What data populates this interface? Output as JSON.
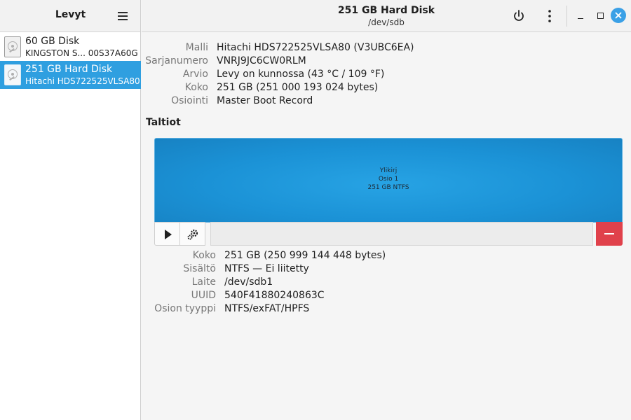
{
  "sidebar": {
    "title": "Levyt",
    "menu_icon": "hamburger-menu-icon",
    "disks": [
      {
        "name": "60 GB Disk",
        "subtitle": "KINGSTON S... 00S37A60G",
        "icon": "hard-disk-icon",
        "selected": false
      },
      {
        "name": "251 GB Hard Disk",
        "subtitle": "Hitachi HDS722525VLSA80",
        "icon": "hard-disk-icon",
        "selected": true
      }
    ]
  },
  "header": {
    "title": "251 GB Hard Disk",
    "subtitle": "/dev/sdb",
    "power_icon": "power-icon",
    "menu_icon": "vertical-dots-icon",
    "accent_close": "#3aa0e6"
  },
  "disk_info": [
    {
      "label": "Malli",
      "value": "Hitachi HDS722525VLSA80 (V3UBC6EA)"
    },
    {
      "label": "Sarjanumero",
      "value": "VNRJ9JC6CW0RLM"
    },
    {
      "label": "Arvio",
      "value": "Levy on kunnossa (43 °C / 109 °F)"
    },
    {
      "label": "Koko",
      "value": "251 GB (251 000 193 024 bytes)"
    },
    {
      "label": "Osiointi",
      "value": "Master Boot Record"
    }
  ],
  "volumes": {
    "section_title": "Taltiot",
    "block": {
      "line1": "Ylikirj",
      "line2": "Osio 1",
      "line3": "251 GB NTFS",
      "color": "#1b92d6"
    },
    "toolbar": {
      "play_icon": "play-icon",
      "gear_icon": "gears-icon",
      "delete_icon": "minus-icon",
      "delete_color": "#e0414b"
    }
  },
  "volume_info": [
    {
      "label": "Koko",
      "value": "251 GB (250 999 144 448 bytes)"
    },
    {
      "label": "Sisältö",
      "value": "NTFS — Ei liitetty"
    },
    {
      "label": "Laite",
      "value": "/dev/sdb1"
    },
    {
      "label": "UUID",
      "value": "540F41880240863C"
    },
    {
      "label": "Osion tyyppi",
      "value": "NTFS/exFAT/HPFS"
    }
  ]
}
